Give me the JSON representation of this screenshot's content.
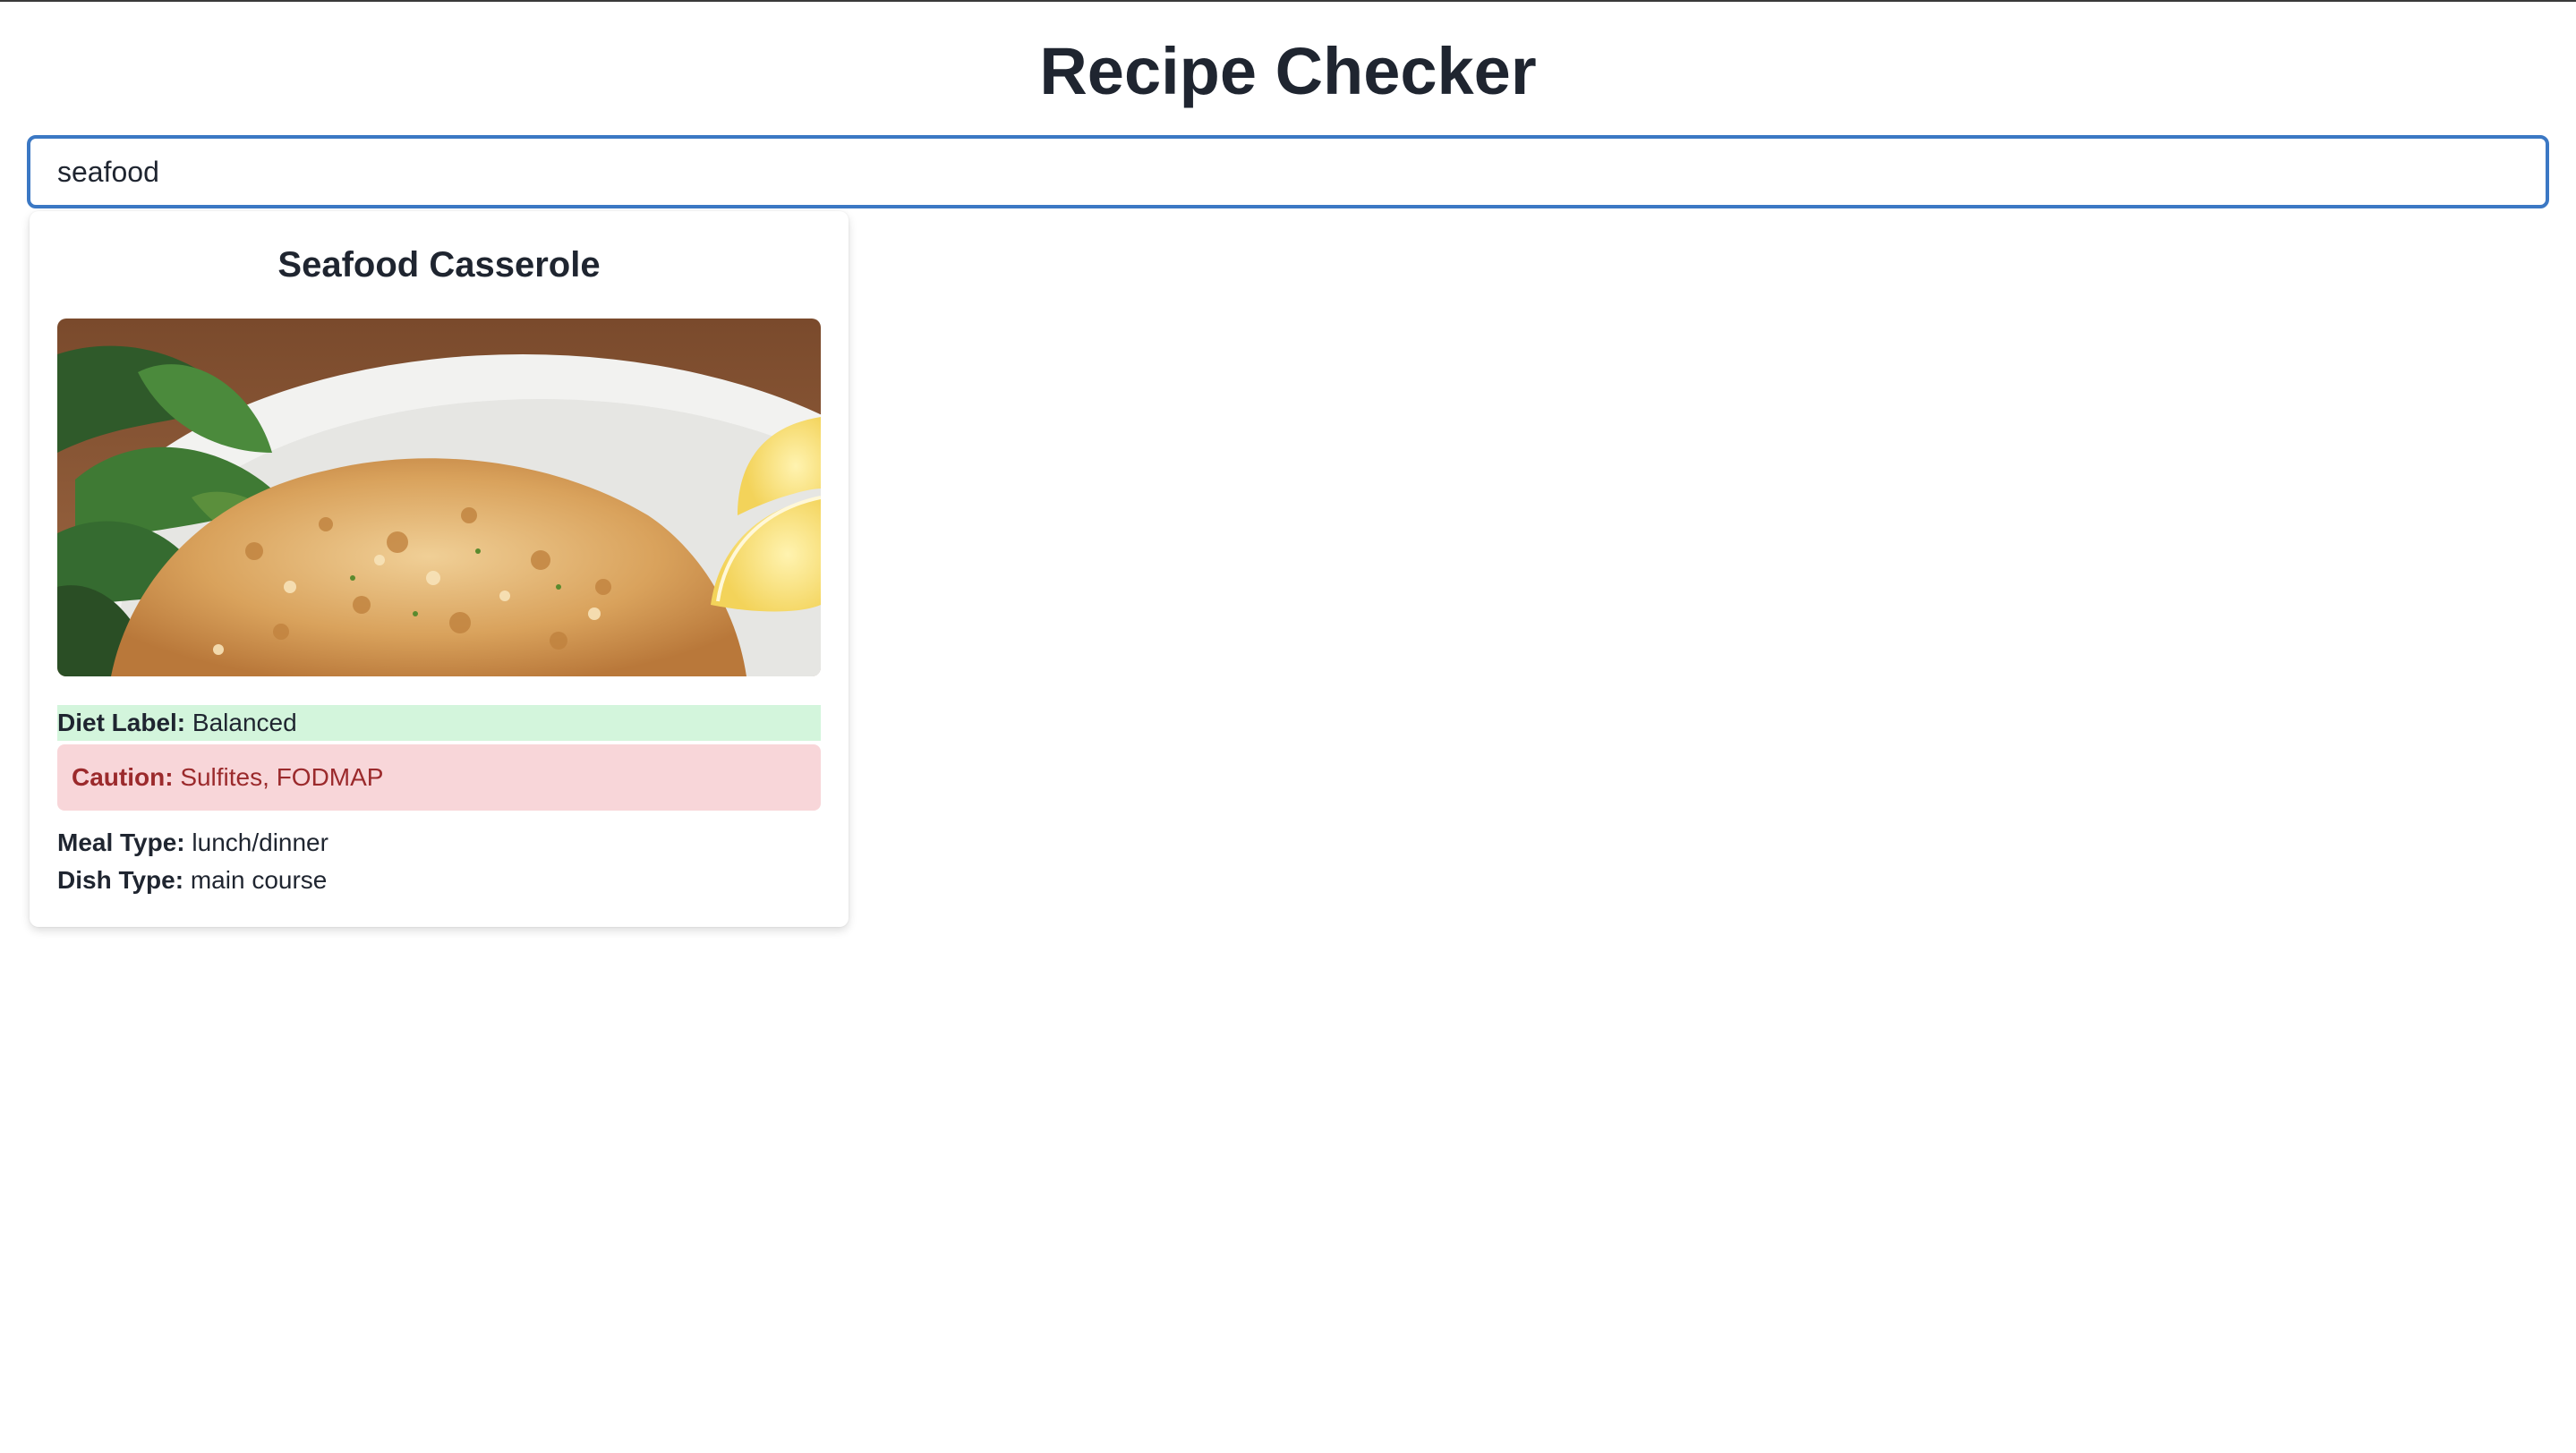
{
  "app": {
    "title": "Recipe Checker"
  },
  "search": {
    "value": "seafood",
    "placeholder": ""
  },
  "results": [
    {
      "title": "Seafood Casserole",
      "image_icon": "food-photo",
      "diet_label": {
        "label": "Diet Label:",
        "value": "Balanced"
      },
      "caution": {
        "label": "Caution:",
        "value": "Sulfites, FODMAP"
      },
      "meal_type": {
        "label": "Meal Type:",
        "value": "lunch/dinner"
      },
      "dish_type": {
        "label": "Dish Type:",
        "value": "main course"
      }
    }
  ],
  "colors": {
    "accent": "#3b78c4",
    "diet_bg": "#d3f5dc",
    "caution_bg": "#f8d6d9",
    "caution_text": "#9b2a2c"
  }
}
